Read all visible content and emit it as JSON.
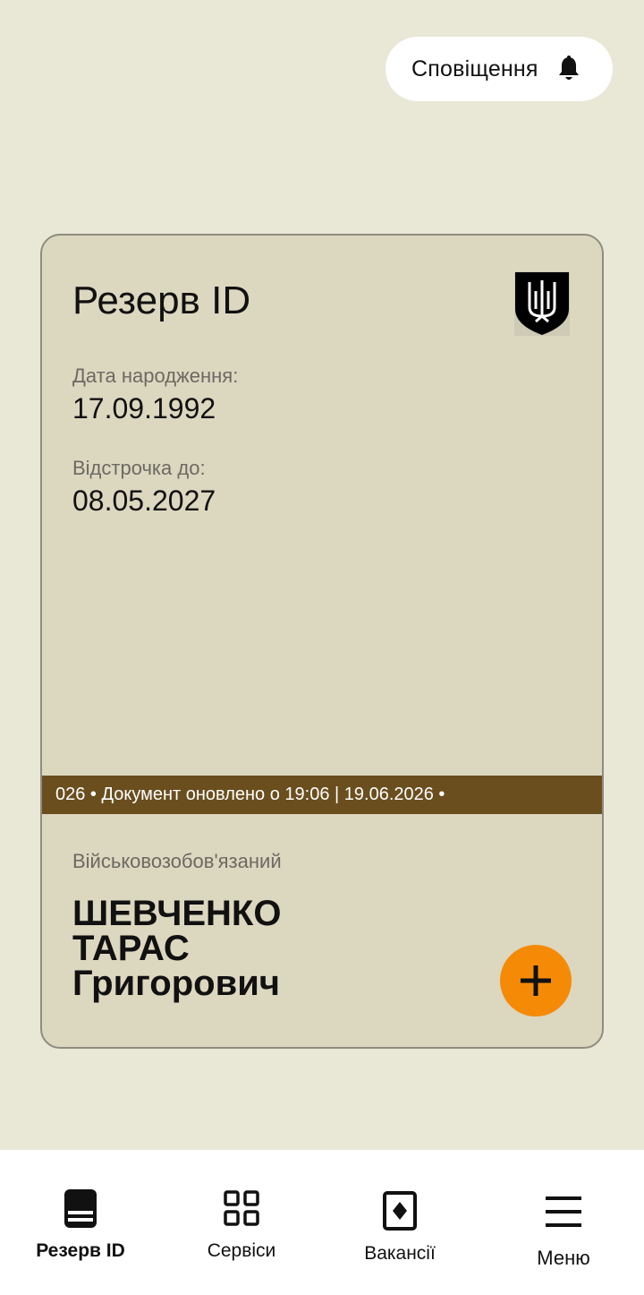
{
  "header": {
    "notifications_label": "Сповіщення",
    "notifications_icon": "bell-icon"
  },
  "card": {
    "title": "Резерв ID",
    "emblem_icon": "trident-shield-icon",
    "birth_date_label": "Дата народження:",
    "birth_date_value": "17.09.1992",
    "deferment_label": "Відстрочка до:",
    "deferment_value": "08.05.2027",
    "ticker_text": "026 • Документ оновлено о 19:06 | 19.06.2026 •",
    "status": "Військовозобов'язаний",
    "surname": "ШЕВЧЕНКО",
    "given_name": "ТАРАС",
    "patronymic": "Григорович",
    "add_icon": "plus-icon",
    "colors": {
      "card_bg": "#dcd7bf",
      "ticker_bg": "#6a4e1e",
      "add_button": "#f58a07",
      "page_bg": "#e9e7d6"
    }
  },
  "bottom_nav": {
    "items": [
      {
        "label": "Резерв ID",
        "icon": "document-icon",
        "active": true
      },
      {
        "label": "Сервіси",
        "icon": "grid-icon",
        "active": false
      },
      {
        "label": "Вакансії",
        "icon": "vacancy-icon",
        "active": false
      },
      {
        "label": "Меню",
        "icon": "menu-icon",
        "active": false
      }
    ]
  }
}
